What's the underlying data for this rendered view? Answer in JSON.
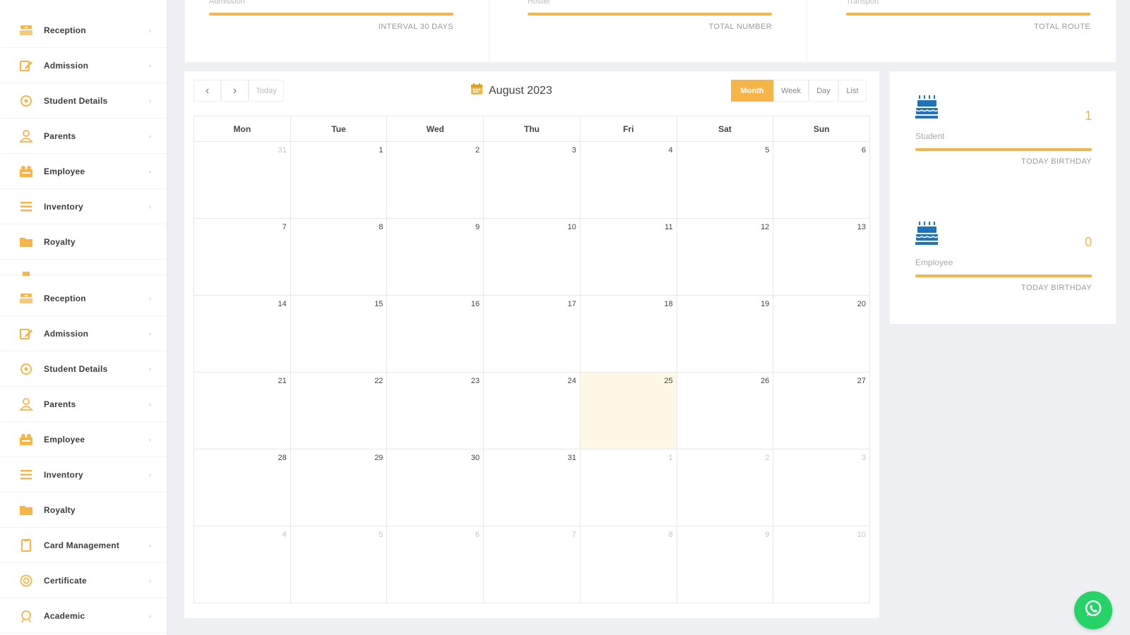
{
  "sidebar": {
    "items": [
      {
        "label": "Reception",
        "icon": "reception-desk-icon",
        "arrow": "›"
      },
      {
        "label": "Admission",
        "icon": "edit-form-icon",
        "arrow": "›"
      },
      {
        "label": "Student Details",
        "icon": "student-details-icon",
        "arrow": "›"
      },
      {
        "label": "Parents",
        "icon": "user-icon",
        "arrow": "›"
      },
      {
        "label": "Employee",
        "icon": "employee-icon",
        "arrow": "›"
      },
      {
        "label": "Inventory",
        "icon": "list-icon",
        "arrow": "›"
      },
      {
        "label": "Royalty",
        "icon": "folder-icon",
        "arrow": ""
      },
      {
        "label": "Reception",
        "icon": "reception-desk-icon",
        "arrow": "›"
      },
      {
        "label": "Admission",
        "icon": "edit-form-icon",
        "arrow": "›"
      },
      {
        "label": "Student Details",
        "icon": "student-details-icon",
        "arrow": "›"
      },
      {
        "label": "Parents",
        "icon": "user-icon",
        "arrow": "›"
      },
      {
        "label": "Employee",
        "icon": "employee-icon",
        "arrow": "›"
      },
      {
        "label": "Inventory",
        "icon": "list-icon",
        "arrow": "›"
      },
      {
        "label": "Royalty",
        "icon": "folder-icon",
        "arrow": ""
      },
      {
        "label": "Card Management",
        "icon": "card-icon",
        "arrow": "›"
      },
      {
        "label": "Certificate",
        "icon": "certificate-icon",
        "arrow": "›"
      },
      {
        "label": "Academic",
        "icon": "academic-icon",
        "arrow": "›"
      }
    ]
  },
  "stats": [
    {
      "title": "Admission",
      "subtitle": "INTERVAL 30 DAYS"
    },
    {
      "title": "Hostel",
      "subtitle": "TOTAL NUMBER"
    },
    {
      "title": "Transport",
      "subtitle": "TOTAL ROUTE"
    }
  ],
  "calendar": {
    "title": "August 2023",
    "nav": {
      "prev": "‹",
      "next": "›",
      "today": "Today"
    },
    "views": [
      "Month",
      "Week",
      "Day",
      "List"
    ],
    "active_view": "Month",
    "weekdays": [
      "Mon",
      "Tue",
      "Wed",
      "Thu",
      "Fri",
      "Sat",
      "Sun"
    ],
    "weeks": [
      [
        {
          "n": "31",
          "o": true
        },
        {
          "n": "1"
        },
        {
          "n": "2"
        },
        {
          "n": "3"
        },
        {
          "n": "4"
        },
        {
          "n": "5"
        },
        {
          "n": "6"
        }
      ],
      [
        {
          "n": "7"
        },
        {
          "n": "8"
        },
        {
          "n": "9"
        },
        {
          "n": "10"
        },
        {
          "n": "11"
        },
        {
          "n": "12"
        },
        {
          "n": "13"
        }
      ],
      [
        {
          "n": "14"
        },
        {
          "n": "15"
        },
        {
          "n": "16"
        },
        {
          "n": "17"
        },
        {
          "n": "18"
        },
        {
          "n": "19"
        },
        {
          "n": "20"
        }
      ],
      [
        {
          "n": "21"
        },
        {
          "n": "22"
        },
        {
          "n": "23"
        },
        {
          "n": "24"
        },
        {
          "n": "25",
          "t": true
        },
        {
          "n": "26"
        },
        {
          "n": "27"
        }
      ],
      [
        {
          "n": "28"
        },
        {
          "n": "29"
        },
        {
          "n": "30"
        },
        {
          "n": "31"
        },
        {
          "n": "1",
          "o": true
        },
        {
          "n": "2",
          "o": true
        },
        {
          "n": "3",
          "o": true
        }
      ],
      [
        {
          "n": "4",
          "o": true
        },
        {
          "n": "5",
          "o": true
        },
        {
          "n": "6",
          "o": true
        },
        {
          "n": "7",
          "o": true
        },
        {
          "n": "8",
          "o": true
        },
        {
          "n": "9",
          "o": true
        },
        {
          "n": "10",
          "o": true
        }
      ]
    ]
  },
  "birthdays": [
    {
      "label": "Student",
      "count": "1",
      "subtitle": "TODAY BIRTHDAY"
    },
    {
      "label": "Employee",
      "count": "0",
      "subtitle": "TODAY BIRTHDAY"
    }
  ],
  "colors": {
    "accent": "#f7b548",
    "cake": "#1e73be",
    "whatsapp": "#25d366"
  }
}
